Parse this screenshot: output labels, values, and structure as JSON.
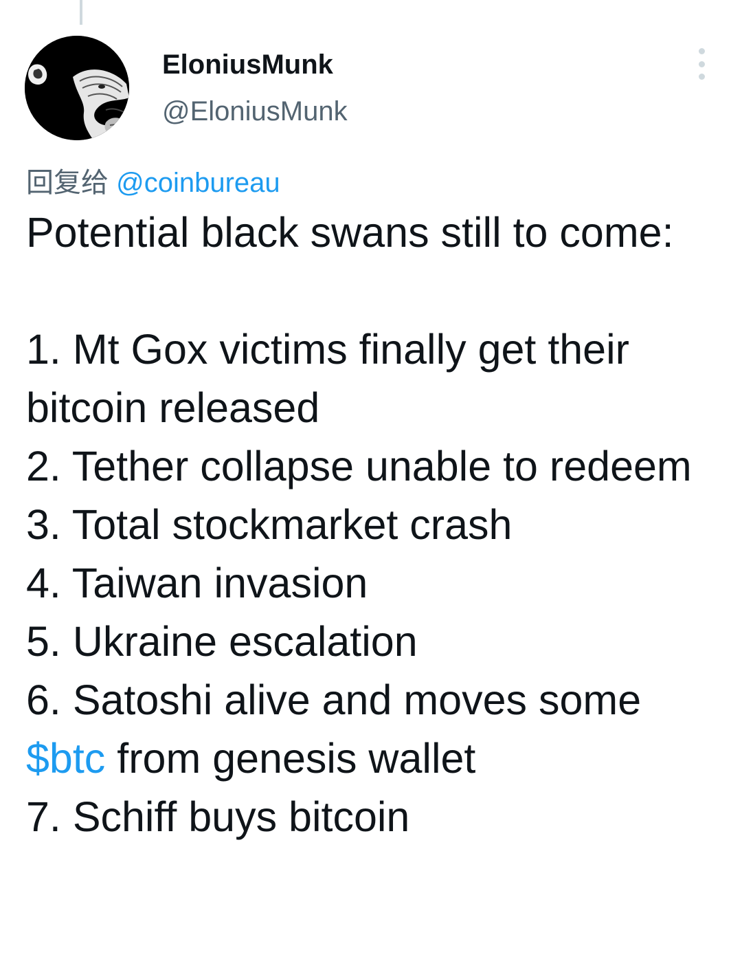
{
  "author": {
    "display_name": "EloniusMunk",
    "handle": "@EloniusMunk",
    "avatar_icon": "chimpanzee-avatar-icon"
  },
  "reply_to": {
    "prefix": "回复给",
    "mention": "@coinbureau"
  },
  "tweet": {
    "intro": "Potential black swans still to come:",
    "items": {
      "1": "1. Mt Gox victims finally get their bitcoin released",
      "2": "2. Tether collapse unable to redeem",
      "3": "3. Total stockmarket crash",
      "4": "4. Taiwan invasion",
      "5": "5. Ukraine escalation",
      "6_before": "6. Satoshi alive and moves some",
      "6_cashtag": "$btc",
      "6_after": " from genesis wallet",
      "7": "7. Schiff buys bitcoin"
    }
  },
  "more_icon": "more-options-icon",
  "colors": {
    "link": "#1d9bf0",
    "text": "#0f1419",
    "secondary": "#536471",
    "thread_line": "#cfd9de"
  }
}
